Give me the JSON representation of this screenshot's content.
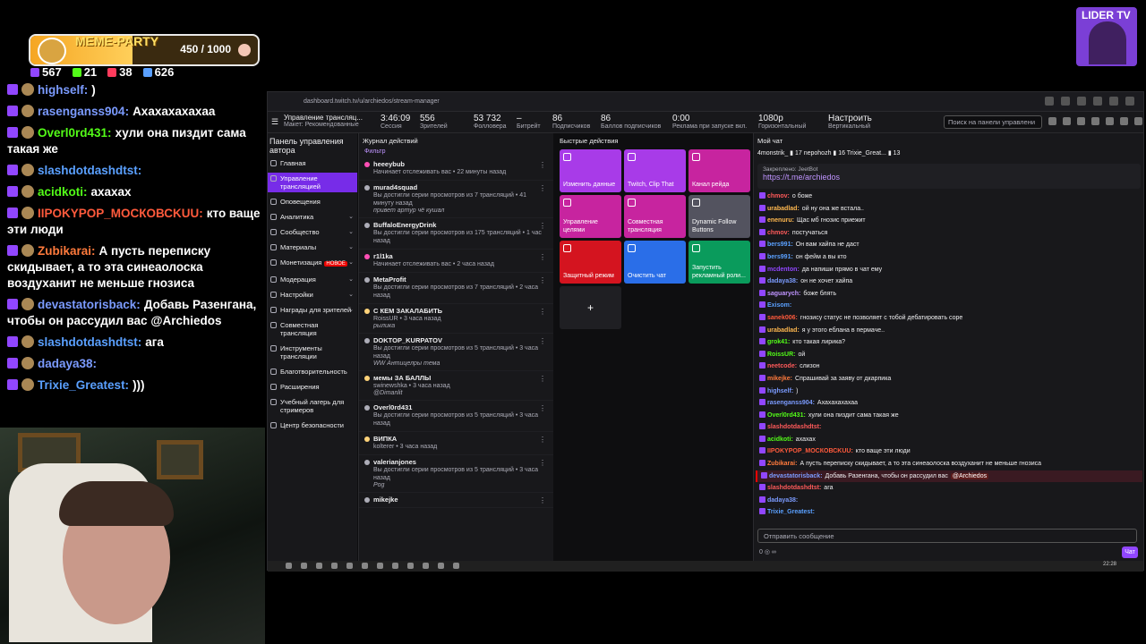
{
  "overlay": {
    "meme_title": "MEME-PARTY",
    "meme_value": "450 / 1000",
    "meme_progress": 0.45,
    "stats": [
      {
        "icon": "twitch-icon",
        "value": "567",
        "color": "#9146ff"
      },
      {
        "icon": "kick-icon",
        "value": "21",
        "color": "#53fc18"
      },
      {
        "icon": "vk-icon",
        "value": "38",
        "color": "#ff3b5c"
      },
      {
        "icon": "viewers-icon",
        "value": "626",
        "color": "#5aa0ff"
      }
    ],
    "messages": [
      {
        "user": "highself:",
        "text": ")",
        "color": "#7b9bff"
      },
      {
        "user": "rasenganss904:",
        "text": "Ахахахахахаа",
        "color": "#7b9bff"
      },
      {
        "user": "Overl0rd431:",
        "text": "хули она пиздит сама такая же",
        "color": "#53fc18"
      },
      {
        "user": "slashdotdashdtst:",
        "text": "",
        "color": "#5aa0ff"
      },
      {
        "user": "acidkoti:",
        "text": "ахахах",
        "color": "#53fc18"
      },
      {
        "user": "IIPOKYPOP_МОСКОВСKUU:",
        "text": "кто ваще эти люди",
        "color": "#ff5a3c"
      },
      {
        "user": "Zubikarai:",
        "text": "А пусть переписку скидывает, а то эта синеаолоска воздуханит не меньше гнозиса",
        "color": "#ff7a3c"
      },
      {
        "user": "devastatorisback:",
        "text": "Добавь Разенгана, чтобы он рассудил вас @Archiedos",
        "color": "#7b9bff"
      },
      {
        "user": "slashdotdashdtst:",
        "text": "ага",
        "color": "#5aa0ff"
      },
      {
        "user": "dadaya38:",
        "text": "",
        "color": "#7b9bff"
      },
      {
        "user": "Trixie_Greatest:",
        "text": ")))",
        "color": "#5aa0ff"
      }
    ],
    "lider_title": "LIDER TV"
  },
  "browser": {
    "url": "dashboard.twitch.tv/u/archiedos/stream-manager"
  },
  "topbar": {
    "title": "Управление трансляц...",
    "subtitle": "Макет: Рекомендованные",
    "items": [
      {
        "value": "3:46:09",
        "label": "Сессия"
      },
      {
        "value": "556",
        "label": "Зрителей"
      },
      {
        "value": "53 732",
        "label": "Фолловера"
      },
      {
        "value": "–",
        "label": "Битрейт"
      },
      {
        "value": "86",
        "label": "Подписчиков"
      },
      {
        "value": "86",
        "label": "Баллов подписчиков"
      },
      {
        "value": "0:00",
        "label": "Реклама при запуске вкл."
      },
      {
        "value": "1080p",
        "label": "Горизонтальный"
      },
      {
        "value": "Настроить",
        "label": "Вертикальный"
      }
    ],
    "search_placeholder": "Поиск на панели управлени"
  },
  "sidebar": {
    "header": "Панель управления автора",
    "items": [
      {
        "label": "Главная",
        "active": false,
        "chev": false,
        "new": false
      },
      {
        "label": "Управление трансляцией",
        "active": true,
        "chev": false,
        "new": false
      },
      {
        "label": "Оповещения",
        "active": false,
        "chev": false,
        "new": false
      },
      {
        "label": "Аналитика",
        "active": false,
        "chev": true,
        "new": false
      },
      {
        "label": "Сообщество",
        "active": false,
        "chev": true,
        "new": false
      },
      {
        "label": "Материалы",
        "active": false,
        "chev": true,
        "new": false
      },
      {
        "label": "Монетизация",
        "active": false,
        "chev": true,
        "new": true
      },
      {
        "label": "Модерация",
        "active": false,
        "chev": true,
        "new": false
      },
      {
        "label": "Настройки",
        "active": false,
        "chev": true,
        "new": false
      },
      {
        "label": "Награды для зрителей",
        "active": false,
        "chev": true,
        "new": false
      },
      {
        "label": "Совместная трансляция",
        "active": false,
        "chev": false,
        "new": false
      },
      {
        "label": "Инструменты трансляции",
        "active": false,
        "chev": false,
        "new": false
      },
      {
        "label": "Благотворительность",
        "active": false,
        "chev": false,
        "new": false
      },
      {
        "label": "Расширения",
        "active": false,
        "chev": false,
        "new": false
      },
      {
        "label": "Учебный лагерь для стримеров",
        "active": false,
        "chev": false,
        "new": false
      },
      {
        "label": "Центр безопасности",
        "active": false,
        "chev": false,
        "new": false
      }
    ],
    "new_badge": "НОВОЕ"
  },
  "feed": {
    "title": "Журнал действий",
    "filter": "Фильтр",
    "entries": [
      {
        "name": "heeeybub",
        "desc": "Начинает отслеживать вас • 22 минуты назад",
        "quote": "",
        "icon": "#ff4fb5"
      },
      {
        "name": "murad4squad",
        "desc": "Вы достигли серии просмотров из 7 трансляций • 41 минуту назад",
        "quote": "привет артур чё кушал",
        "icon": "#adadb8"
      },
      {
        "name": "BuffaloEnergyDrink",
        "desc": "Вы достигли серии просмотров из 175 трансляций • 1 час назад",
        "quote": "",
        "icon": "#adadb8"
      },
      {
        "name": "r1l1ka",
        "desc": "Начинает отслеживать вас • 2 часа назад",
        "quote": "",
        "icon": "#ff4fb5"
      },
      {
        "name": "MetaProfit",
        "desc": "Вы достигли серии просмотров из 7 трансляций • 2 часа назад",
        "quote": "",
        "icon": "#adadb8"
      },
      {
        "name": "С КЕМ ЗАКАЛАБИТЬ",
        "desc": "RoissUR • 3 часа назад",
        "quote": "рылика",
        "icon": "#ffd37a"
      },
      {
        "name": "DOKTOP_KURPATOV",
        "desc": "Вы достигли серии просмотров из 5 трансляций • 3 часа назад",
        "quote": "WW Антицелры тема",
        "icon": "#adadb8"
      },
      {
        "name": "мемы ЗА БАЛЛЫ",
        "desc": "swinewshka • 3 часа назад",
        "quote": "@Dimanlit",
        "icon": "#ffd37a"
      },
      {
        "name": "Overl0rd431",
        "desc": "Вы достигли серии просмотров из 5 трансляций • 3 часа назад",
        "quote": "",
        "icon": "#adadb8"
      },
      {
        "name": "ВИПКА",
        "desc": "kolterer • 3 часа назад",
        "quote": "",
        "icon": "#ffd37a"
      },
      {
        "name": "valerianjones",
        "desc": "Вы достигли серии просмотров из 5 трансляций • 3 часа назад",
        "quote": "Pog",
        "icon": "#adadb8"
      },
      {
        "name": "mikejke",
        "desc": "",
        "quote": "",
        "icon": "#adadb8"
      }
    ]
  },
  "quick_actions": {
    "title": "Быстрые действия",
    "tiles": [
      {
        "label": "Изменить данные",
        "color": "#a83be8"
      },
      {
        "label": "Twitch, Clip That",
        "color": "#a83be8"
      },
      {
        "label": "Канал рейда",
        "color": "#c7249f"
      },
      {
        "label": "Управление целями",
        "color": "#c7249f"
      },
      {
        "label": "Совместная трансляция",
        "color": "#c7249f"
      },
      {
        "label": "Dynamic Follow Buttons",
        "color": "#53535f"
      },
      {
        "label": "Защитный режим",
        "color": "#d4141f"
      },
      {
        "label": "Очистить чат",
        "color": "#2a6ee8"
      },
      {
        "label": "Запустить рекламный роли...",
        "color": "#0a9b5c"
      }
    ],
    "add": "+"
  },
  "chat": {
    "title": "Мой чат",
    "viewers": "4monstrik_ ▮ 17   nepohozh ▮ 16   Trixie_Great... ▮ 13",
    "pinned_label": "Закреплено: JeetBot",
    "pinned_url": "https://t.me/archiedos",
    "messages": [
      {
        "user": "chmov:",
        "text": "о боже",
        "color": "#ff5a5a"
      },
      {
        "user": "urabadlad:",
        "text": "ой ну она же встала..",
        "color": "#ffb84f"
      },
      {
        "user": "enenuru:",
        "text": "Щас мб гнозис приежит",
        "color": "#ffb84f"
      },
      {
        "user": "chmov:",
        "text": "постучаться",
        "color": "#ff5a5a"
      },
      {
        "user": "bers991:",
        "text": "Он вам хайпа не даст",
        "color": "#5aa0ff"
      },
      {
        "user": "bers991:",
        "text": "он фейм а вы кто",
        "color": "#5aa0ff"
      },
      {
        "user": "mcdenton:",
        "text": "да напиши прямо в чат ему",
        "color": "#9146ff"
      },
      {
        "user": "dadaya38:",
        "text": "он не хочет хайпа",
        "color": "#7b9bff"
      },
      {
        "user": "saguarych:",
        "text": "боже блять",
        "color": "#bf94ff"
      },
      {
        "user": "Exisom:",
        "text": "",
        "color": "#5aa0ff"
      },
      {
        "user": "sanek006:",
        "text": "гнозису статус не позволяет с тобой дебатировать соре",
        "color": "#ff5a3c"
      },
      {
        "user": "urabadlad:",
        "text": "я у этого еблана в пермаче..",
        "color": "#ffb84f"
      },
      {
        "user": "grok41:",
        "text": "кто такая лирика?",
        "color": "#53fc18"
      },
      {
        "user": "RoissUR:",
        "text": "ой",
        "color": "#53fc18"
      },
      {
        "user": "neetcode:",
        "text": "слизон",
        "color": "#ff5a5a"
      },
      {
        "user": "mikejke:",
        "text": "Спрашивай за заяву от дкарпика",
        "color": "#ff7a3c"
      },
      {
        "user": "highself:",
        "text": ")",
        "color": "#7b9bff"
      },
      {
        "user": "rasenganss904:",
        "text": "Ахахахахахаа",
        "color": "#7b9bff"
      },
      {
        "user": "Overl0rd431:",
        "text": "хули она пиздит сама такая же",
        "color": "#53fc18"
      },
      {
        "user": "slashdotdashdtst:",
        "text": "",
        "color": "#ff5a5a"
      },
      {
        "user": "acidkoti:",
        "text": "ахахах",
        "color": "#53fc18"
      },
      {
        "user": "IIPOKYPOP_МОСКОВСKUU:",
        "text": "кто ваще эти люди",
        "color": "#ff5a3c"
      },
      {
        "user": "Zubikarai:",
        "text": "А пусть переписку скидывает, а то эта синеаолоска воздуханит не меньше гнозиса",
        "color": "#ff7a3c"
      },
      {
        "user": "devastatorisback:",
        "text": "Добавь Разенгана, чтобы он рассудил вас",
        "color": "#7b9bff",
        "mention": "@Archiedos"
      },
      {
        "user": "slashdotdashdtst:",
        "text": "ага",
        "color": "#ff5a5a"
      },
      {
        "user": "dadaya38:",
        "text": "",
        "color": "#7b9bff"
      },
      {
        "user": "Trixie_Greatest:",
        "text": "",
        "color": "#5aa0ff"
      }
    ],
    "input_placeholder": "Отправить сообщение",
    "bottom": "0 ◎ ∞",
    "send_label": "Чат"
  },
  "taskbar": {
    "clock": "22:28"
  }
}
